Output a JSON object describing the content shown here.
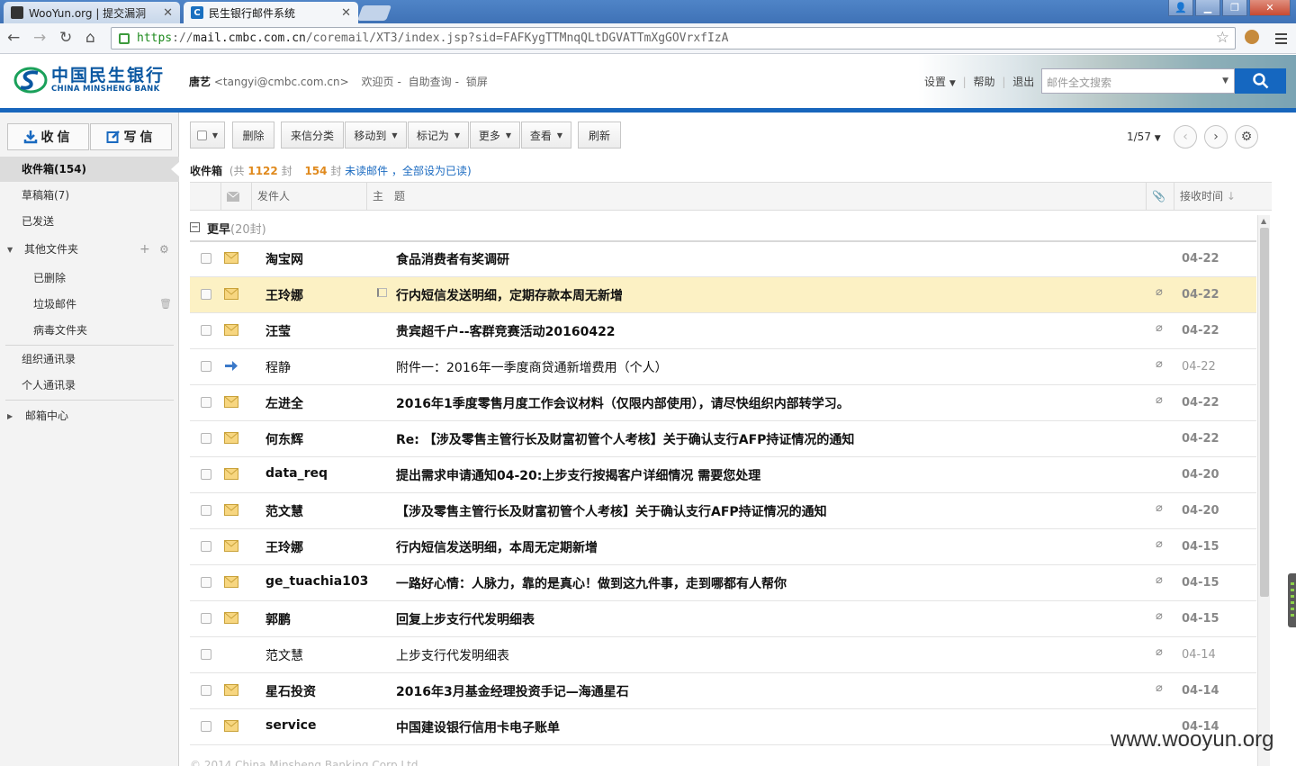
{
  "browser": {
    "tabs": [
      {
        "label": "WooYun.org | 提交漏洞",
        "active": false
      },
      {
        "label": "民生银行邮件系统",
        "active": true
      }
    ],
    "url": {
      "scheme": "https",
      "sep": "://",
      "domain": "mail.cmbc.com.cn",
      "path": "/coremail/XT3/index.jsp?sid=FAFKygTTMnqQLtDGVATTmXgGOVrxfIzA"
    }
  },
  "header": {
    "logo_cn": "中国民生银行",
    "logo_en": "CHINA MINSHENG BANK",
    "user_name": "唐艺",
    "user_email": "<tangyi@cmbc.com.cn>",
    "links": [
      "欢迎页",
      "自助查询",
      "锁屏"
    ],
    "settings_label": "设置",
    "help_label": "帮助",
    "logout_label": "退出",
    "search_placeholder": "邮件全文搜索"
  },
  "sidebar": {
    "receive_label": "收信",
    "compose_label": "写信",
    "inbox_label": "收件箱(154)",
    "drafts_label": "草稿箱(7)",
    "sent_label": "已发送",
    "other_label": "其他文件夹",
    "deleted_label": "已删除",
    "junk_label": "垃圾邮件",
    "virus_label": "病毒文件夹",
    "org_contacts_label": "组织通讯录",
    "personal_contacts_label": "个人通讯录",
    "mailbox_center_label": "邮箱中心"
  },
  "toolbar": {
    "delete": "删除",
    "classify": "来信分类",
    "move_to": "移动到",
    "mark_as": "标记为",
    "more": "更多",
    "view": "查看",
    "refresh": "刷新",
    "page": "1/57"
  },
  "folder": {
    "title": "收件箱",
    "total_prefix": "(共",
    "total": "1122",
    "total_suffix": "封",
    "unread": "154",
    "unread_suffix": "封",
    "unread_link": "未读邮件",
    "mark_all_link": "，全部设为已读)"
  },
  "columns": {
    "sender": "发件人",
    "subject": "主　题",
    "received": "接收时间"
  },
  "group": {
    "label": "更早",
    "count": "(20封)"
  },
  "emails": [
    {
      "from": "淘宝网",
      "subject": "食品消费者有奖调研",
      "date": "04-22",
      "unread": true,
      "attach": false,
      "icon": "envelope",
      "flag": false,
      "highlight": false
    },
    {
      "from": "王玲娜",
      "subject": "行内短信发送明细，定期存款本周无新增",
      "date": "04-22",
      "unread": true,
      "attach": true,
      "icon": "envelope",
      "flag": true,
      "highlight": true
    },
    {
      "from": "汪莹",
      "subject": "贵宾超千户--客群竞赛活动20160422",
      "date": "04-22",
      "unread": true,
      "attach": true,
      "icon": "envelope",
      "flag": false,
      "highlight": false
    },
    {
      "from": "程静",
      "subject": "附件一：2016年一季度商贷通新增费用（个人）",
      "date": "04-22",
      "unread": false,
      "attach": true,
      "icon": "forward",
      "flag": false,
      "highlight": false
    },
    {
      "from": "左进全",
      "subject": "2016年1季度零售月度工作会议材料（仅限内部使用），请尽快组织内部转学习。",
      "date": "04-22",
      "unread": true,
      "attach": true,
      "icon": "envelope",
      "flag": false,
      "highlight": false
    },
    {
      "from": "何东辉",
      "subject": "Re: 【涉及零售主管行长及财富初管个人考核】关于确认支行AFP持证情况的通知",
      "date": "04-22",
      "unread": true,
      "attach": false,
      "icon": "envelope",
      "flag": false,
      "highlight": false
    },
    {
      "from": "data_req",
      "subject": "提出需求申请通知04-20:上步支行按揭客户详细情况 需要您处理",
      "date": "04-20",
      "unread": true,
      "attach": false,
      "icon": "envelope",
      "flag": false,
      "highlight": false
    },
    {
      "from": "范文慧",
      "subject": "【涉及零售主管行长及财富初管个人考核】关于确认支行AFP持证情况的通知",
      "date": "04-20",
      "unread": true,
      "attach": true,
      "icon": "envelope",
      "flag": false,
      "highlight": false
    },
    {
      "from": "王玲娜",
      "subject": "行内短信发送明细，本周无定期新增",
      "date": "04-15",
      "unread": true,
      "attach": true,
      "icon": "envelope",
      "flag": false,
      "highlight": false
    },
    {
      "from": "ge_tuachia103",
      "subject": "一路好心情：人脉力，靠的是真心！做到这九件事，走到哪都有人帮你",
      "date": "04-15",
      "unread": true,
      "attach": true,
      "icon": "envelope",
      "flag": false,
      "highlight": false
    },
    {
      "from": "郭鹏",
      "subject": "回复上步支行代发明细表",
      "date": "04-15",
      "unread": true,
      "attach": true,
      "icon": "envelope",
      "flag": false,
      "highlight": false
    },
    {
      "from": "范文慧",
      "subject": "上步支行代发明细表",
      "date": "04-14",
      "unread": false,
      "attach": true,
      "icon": "none",
      "flag": false,
      "highlight": false
    },
    {
      "from": "星石投资",
      "subject": "2016年3月基金经理投资手记—海通星石",
      "date": "04-14",
      "unread": true,
      "attach": true,
      "icon": "envelope",
      "flag": false,
      "highlight": false
    },
    {
      "from": "service",
      "subject": "中国建设银行信用卡电子账单",
      "date": "04-14",
      "unread": true,
      "attach": false,
      "icon": "envelope",
      "flag": false,
      "highlight": false
    }
  ],
  "footer": "© 2014 China Minsheng Banking Corp Ltd.",
  "watermark": "www.wooyun.org"
}
